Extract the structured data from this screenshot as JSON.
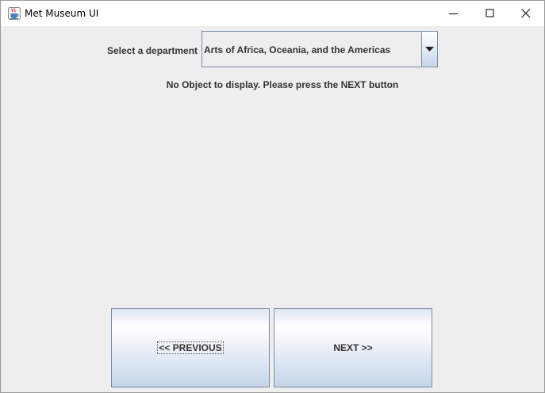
{
  "window": {
    "title": "Met Museum UI",
    "icon": "java-cup-icon",
    "controls": [
      "minimize-icon",
      "maximize-icon",
      "close-icon"
    ]
  },
  "department": {
    "label": "Select a department",
    "selected": "Arts of Africa, Oceania, and the Americas"
  },
  "message": "No Object to display. Please press the NEXT button",
  "buttons": {
    "previous": "<< PREVIOUS",
    "next": "NEXT >>"
  },
  "colors": {
    "background": "#eeeeee",
    "border": "#7a8aa6",
    "text": "#333333"
  }
}
